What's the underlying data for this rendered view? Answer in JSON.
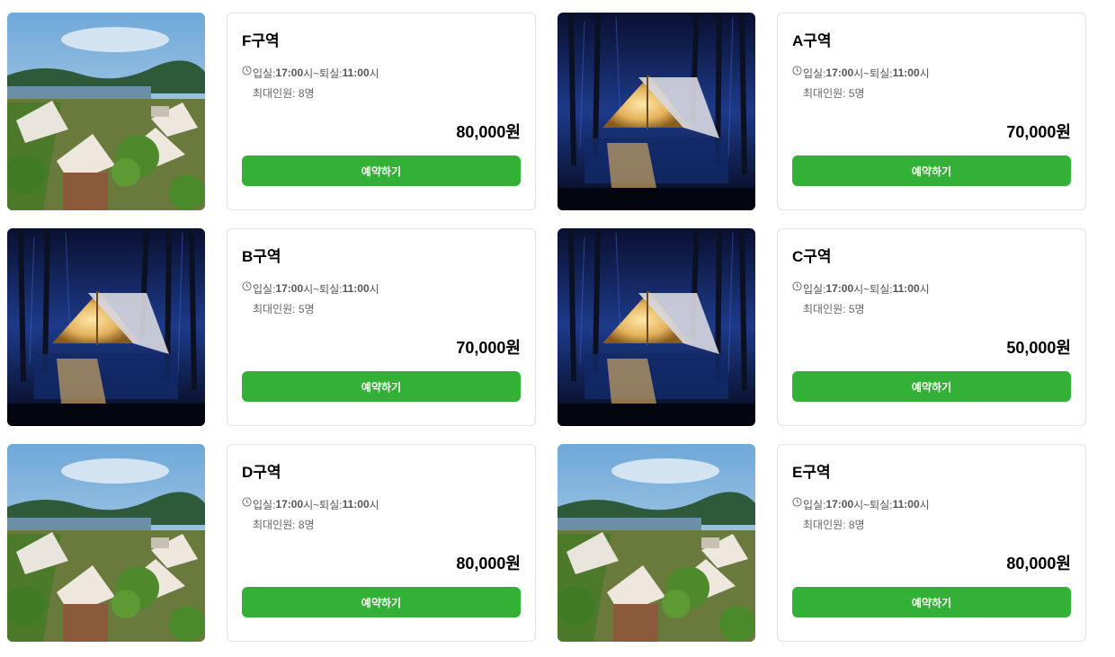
{
  "listings": [
    {
      "zone": "F구역",
      "checkin_label": "입실: ",
      "checkin_time": "17:00",
      "checkout_label": "시~퇴실: ",
      "checkout_time": "11:00",
      "suffix": "시",
      "capacity": "최대인원: 8명",
      "price": "80,000원",
      "button": "예약하기",
      "image": "lakeside-glamping"
    },
    {
      "zone": "A구역",
      "checkin_label": "입실: ",
      "checkin_time": "17:00",
      "checkout_label": "시~퇴실: ",
      "checkout_time": "11:00",
      "suffix": "시",
      "capacity": "최대인원: 5명",
      "price": "70,000원",
      "button": "예약하기",
      "image": "night-forest-tent"
    },
    {
      "zone": "B구역",
      "checkin_label": "입실: ",
      "checkin_time": "17:00",
      "checkout_label": "시~퇴실: ",
      "checkout_time": "11:00",
      "suffix": "시",
      "capacity": "최대인원: 5명",
      "price": "70,000원",
      "button": "예약하기",
      "image": "night-forest-tent"
    },
    {
      "zone": "C구역",
      "checkin_label": "입실: ",
      "checkin_time": "17:00",
      "checkout_label": "시~퇴실: ",
      "checkout_time": "11:00",
      "suffix": "시",
      "capacity": "최대인원: 5명",
      "price": "50,000원",
      "button": "예약하기",
      "image": "night-forest-tent"
    },
    {
      "zone": "D구역",
      "checkin_label": "입실: ",
      "checkin_time": "17:00",
      "checkout_label": "시~퇴실: ",
      "checkout_time": "11:00",
      "suffix": "시",
      "capacity": "최대인원: 8명",
      "price": "80,000원",
      "button": "예약하기",
      "image": "lakeside-glamping"
    },
    {
      "zone": "E구역",
      "checkin_label": "입실: ",
      "checkin_time": "17:00",
      "checkout_label": "시~퇴실: ",
      "checkout_time": "11:00",
      "suffix": "시",
      "capacity": "최대인원: 8명",
      "price": "80,000원",
      "button": "예약하기",
      "image": "lakeside-glamping"
    }
  ],
  "colors": {
    "button": "#33b036",
    "border": "#e3e3e3"
  }
}
